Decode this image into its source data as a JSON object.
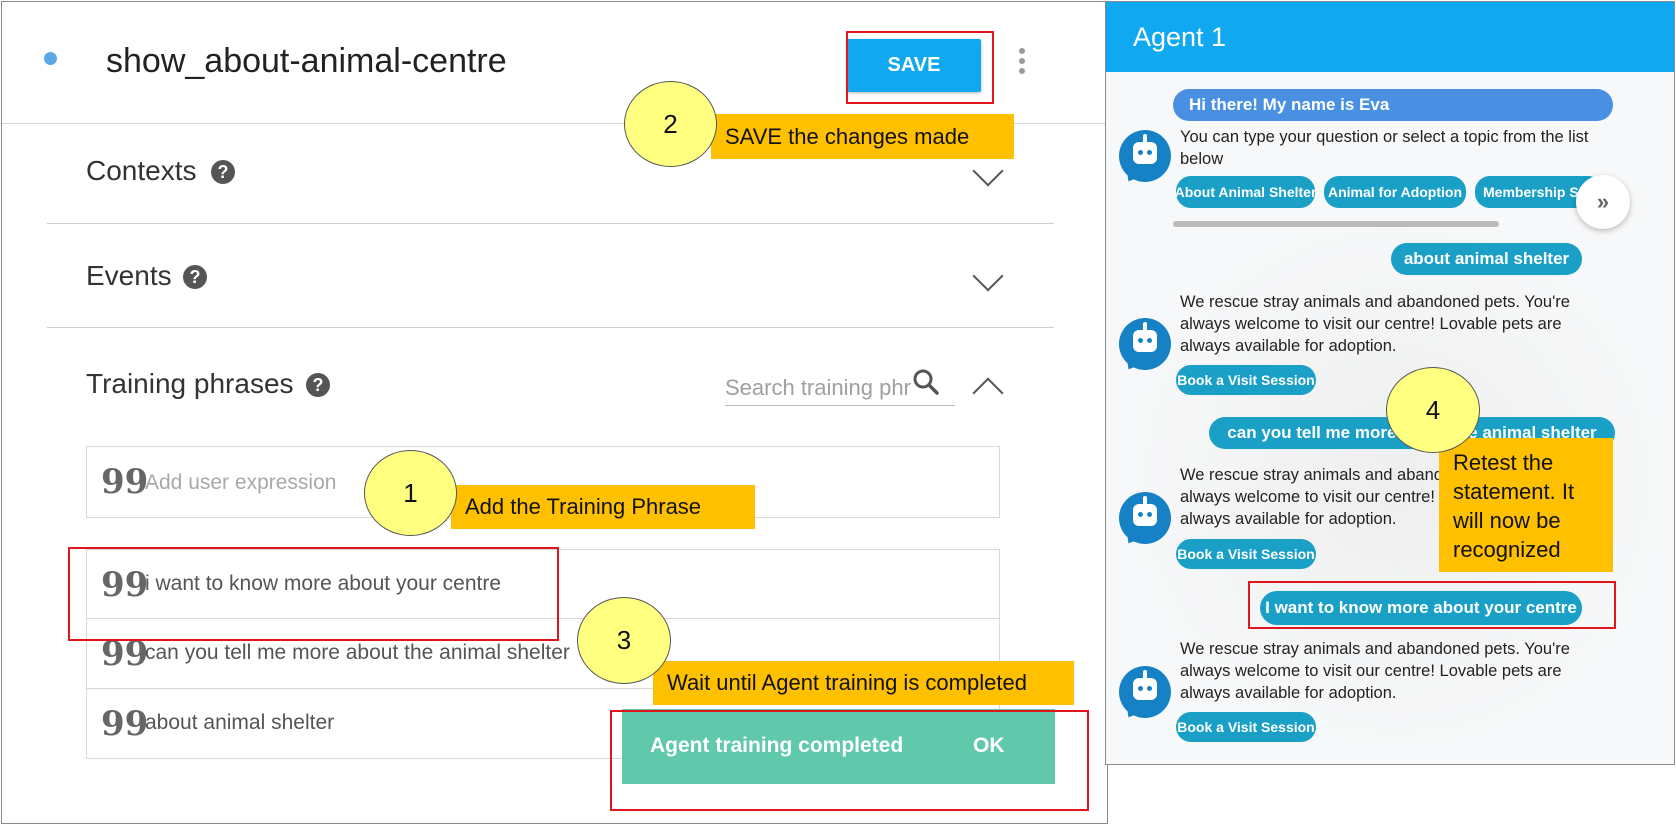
{
  "intent": {
    "title": "show_about-animal-centre",
    "save_label": "SAVE"
  },
  "sections": {
    "contexts": "Contexts",
    "events": "Events",
    "training": "Training phrases",
    "help_glyph": "?"
  },
  "training": {
    "search_placeholder": "Search training phr",
    "add_placeholder": "Add user expression",
    "quote_glyph": "99",
    "phrases": [
      "i want to know more about your centre",
      "can you tell me more about the animal shelter",
      "about animal shelter"
    ]
  },
  "toast": {
    "message": "Agent training completed",
    "ok_label": "OK"
  },
  "annotations": {
    "step1": {
      "number": "1",
      "label": "Add the Training Phrase"
    },
    "step2": {
      "number": "2",
      "label": "SAVE the changes made"
    },
    "step3": {
      "number": "3",
      "label": "Wait until Agent training is completed"
    },
    "step4": {
      "number": "4",
      "label": "Retest the statement. It will now be recognized"
    }
  },
  "chat": {
    "title": "Agent 1",
    "greeting": "Hi there! My name is Eva",
    "intro": "You can type your question or select a topic from the list below",
    "topic_chips": [
      "About Animal Shelter",
      "Animal for Adoption",
      "Membership Sign Up"
    ],
    "next_glyph": "»",
    "user_messages": [
      "about animal shelter",
      "can you tell me more about the animal shelter",
      "I want to know more about your centre"
    ],
    "bot_reply": "We rescue stray animals and abandoned pets. You're always welcome to visit our centre! Lovable pets are always available for adoption.",
    "action_chip": "Book a Visit Session"
  },
  "colors": {
    "accent_blue": "#10a8f0",
    "chip_teal": "#1aa0c7",
    "toast_green": "#60c9ab",
    "callout_yellow": "#ffff80",
    "label_orange": "#ffc000",
    "annotation_red": "#e0161e"
  },
  "icons": {
    "help": "help-circle-icon",
    "search": "search-icon",
    "expand": "chevron-down-icon",
    "collapse": "chevron-up-icon",
    "quote": "quote-icon",
    "menu": "more-vert-icon",
    "bot": "robot-avatar-icon"
  }
}
